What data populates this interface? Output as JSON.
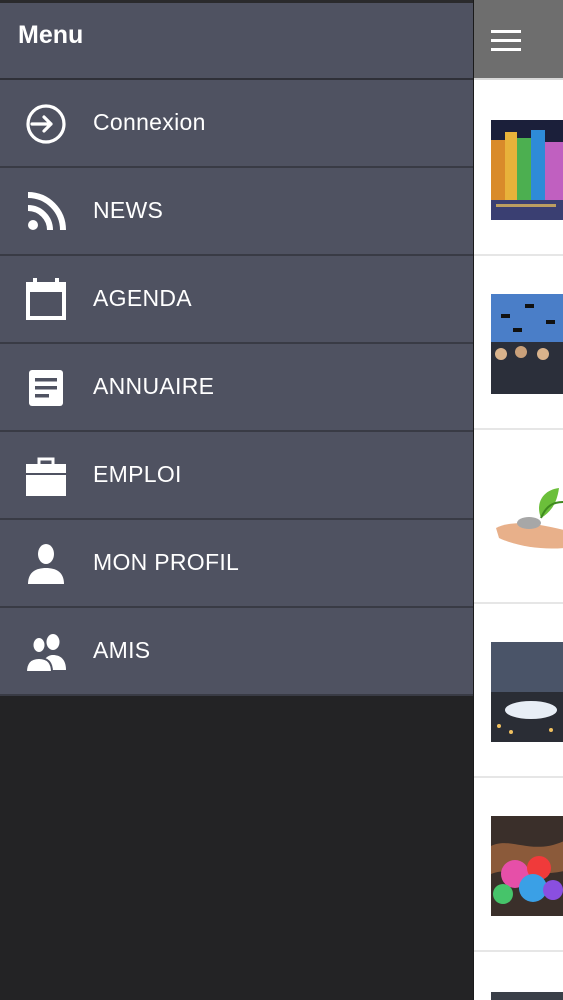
{
  "drawer": {
    "title": "Menu",
    "items": [
      {
        "label": "Connexion",
        "icon": "login-icon"
      },
      {
        "label": "NEWS",
        "icon": "rss-icon"
      },
      {
        "label": "AGENDA",
        "icon": "calendar-icon"
      },
      {
        "label": "ANNUAIRE",
        "icon": "directory-icon"
      },
      {
        "label": "EMPLOI",
        "icon": "briefcase-icon"
      },
      {
        "label": "MON PROFIL",
        "icon": "user-icon"
      },
      {
        "label": "AMIS",
        "icon": "friends-icon"
      }
    ]
  },
  "main": {
    "menu_icon": "hamburger-icon",
    "thumbnails": [
      {
        "subject": "illuminated-building"
      },
      {
        "subject": "graduation-caps"
      },
      {
        "subject": "plant-in-hand"
      },
      {
        "subject": "city-night"
      },
      {
        "subject": "colored-hands"
      }
    ]
  },
  "colors": {
    "drawer_bg": "#4f5261",
    "drawer_divider": "#393b45",
    "backdrop": "#232325",
    "main_header": "#6e6e6e",
    "text": "#ffffff"
  }
}
